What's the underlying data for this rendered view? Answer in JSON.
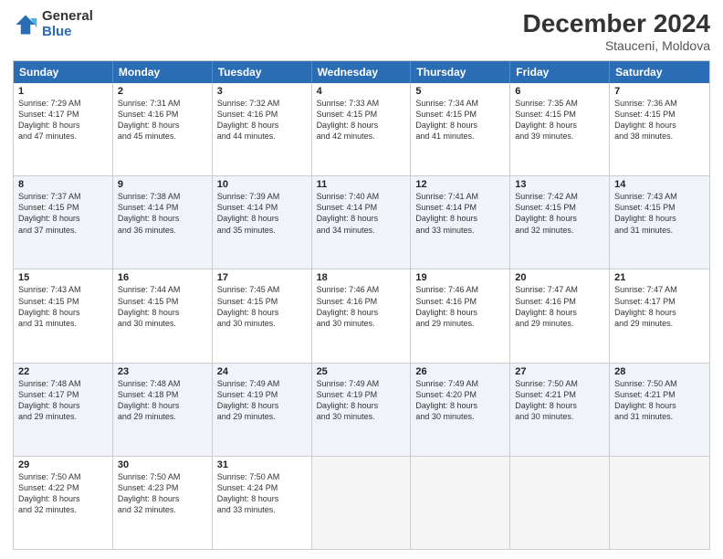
{
  "logo": {
    "general": "General",
    "blue": "Blue"
  },
  "header": {
    "month": "December 2024",
    "location": "Stauceni, Moldova"
  },
  "days_of_week": [
    "Sunday",
    "Monday",
    "Tuesday",
    "Wednesday",
    "Thursday",
    "Friday",
    "Saturday"
  ],
  "weeks": [
    [
      {
        "day": "1",
        "info": "Sunrise: 7:29 AM\nSunset: 4:17 PM\nDaylight: 8 hours\nand 47 minutes."
      },
      {
        "day": "2",
        "info": "Sunrise: 7:31 AM\nSunset: 4:16 PM\nDaylight: 8 hours\nand 45 minutes."
      },
      {
        "day": "3",
        "info": "Sunrise: 7:32 AM\nSunset: 4:16 PM\nDaylight: 8 hours\nand 44 minutes."
      },
      {
        "day": "4",
        "info": "Sunrise: 7:33 AM\nSunset: 4:15 PM\nDaylight: 8 hours\nand 42 minutes."
      },
      {
        "day": "5",
        "info": "Sunrise: 7:34 AM\nSunset: 4:15 PM\nDaylight: 8 hours\nand 41 minutes."
      },
      {
        "day": "6",
        "info": "Sunrise: 7:35 AM\nSunset: 4:15 PM\nDaylight: 8 hours\nand 39 minutes."
      },
      {
        "day": "7",
        "info": "Sunrise: 7:36 AM\nSunset: 4:15 PM\nDaylight: 8 hours\nand 38 minutes."
      }
    ],
    [
      {
        "day": "8",
        "info": "Sunrise: 7:37 AM\nSunset: 4:15 PM\nDaylight: 8 hours\nand 37 minutes."
      },
      {
        "day": "9",
        "info": "Sunrise: 7:38 AM\nSunset: 4:14 PM\nDaylight: 8 hours\nand 36 minutes."
      },
      {
        "day": "10",
        "info": "Sunrise: 7:39 AM\nSunset: 4:14 PM\nDaylight: 8 hours\nand 35 minutes."
      },
      {
        "day": "11",
        "info": "Sunrise: 7:40 AM\nSunset: 4:14 PM\nDaylight: 8 hours\nand 34 minutes."
      },
      {
        "day": "12",
        "info": "Sunrise: 7:41 AM\nSunset: 4:14 PM\nDaylight: 8 hours\nand 33 minutes."
      },
      {
        "day": "13",
        "info": "Sunrise: 7:42 AM\nSunset: 4:15 PM\nDaylight: 8 hours\nand 32 minutes."
      },
      {
        "day": "14",
        "info": "Sunrise: 7:43 AM\nSunset: 4:15 PM\nDaylight: 8 hours\nand 31 minutes."
      }
    ],
    [
      {
        "day": "15",
        "info": "Sunrise: 7:43 AM\nSunset: 4:15 PM\nDaylight: 8 hours\nand 31 minutes."
      },
      {
        "day": "16",
        "info": "Sunrise: 7:44 AM\nSunset: 4:15 PM\nDaylight: 8 hours\nand 30 minutes."
      },
      {
        "day": "17",
        "info": "Sunrise: 7:45 AM\nSunset: 4:15 PM\nDaylight: 8 hours\nand 30 minutes."
      },
      {
        "day": "18",
        "info": "Sunrise: 7:46 AM\nSunset: 4:16 PM\nDaylight: 8 hours\nand 30 minutes."
      },
      {
        "day": "19",
        "info": "Sunrise: 7:46 AM\nSunset: 4:16 PM\nDaylight: 8 hours\nand 29 minutes."
      },
      {
        "day": "20",
        "info": "Sunrise: 7:47 AM\nSunset: 4:16 PM\nDaylight: 8 hours\nand 29 minutes."
      },
      {
        "day": "21",
        "info": "Sunrise: 7:47 AM\nSunset: 4:17 PM\nDaylight: 8 hours\nand 29 minutes."
      }
    ],
    [
      {
        "day": "22",
        "info": "Sunrise: 7:48 AM\nSunset: 4:17 PM\nDaylight: 8 hours\nand 29 minutes."
      },
      {
        "day": "23",
        "info": "Sunrise: 7:48 AM\nSunset: 4:18 PM\nDaylight: 8 hours\nand 29 minutes."
      },
      {
        "day": "24",
        "info": "Sunrise: 7:49 AM\nSunset: 4:19 PM\nDaylight: 8 hours\nand 29 minutes."
      },
      {
        "day": "25",
        "info": "Sunrise: 7:49 AM\nSunset: 4:19 PM\nDaylight: 8 hours\nand 30 minutes."
      },
      {
        "day": "26",
        "info": "Sunrise: 7:49 AM\nSunset: 4:20 PM\nDaylight: 8 hours\nand 30 minutes."
      },
      {
        "day": "27",
        "info": "Sunrise: 7:50 AM\nSunset: 4:21 PM\nDaylight: 8 hours\nand 30 minutes."
      },
      {
        "day": "28",
        "info": "Sunrise: 7:50 AM\nSunset: 4:21 PM\nDaylight: 8 hours\nand 31 minutes."
      }
    ],
    [
      {
        "day": "29",
        "info": "Sunrise: 7:50 AM\nSunset: 4:22 PM\nDaylight: 8 hours\nand 32 minutes."
      },
      {
        "day": "30",
        "info": "Sunrise: 7:50 AM\nSunset: 4:23 PM\nDaylight: 8 hours\nand 32 minutes."
      },
      {
        "day": "31",
        "info": "Sunrise: 7:50 AM\nSunset: 4:24 PM\nDaylight: 8 hours\nand 33 minutes."
      },
      {
        "day": "",
        "info": ""
      },
      {
        "day": "",
        "info": ""
      },
      {
        "day": "",
        "info": ""
      },
      {
        "day": "",
        "info": ""
      }
    ]
  ]
}
